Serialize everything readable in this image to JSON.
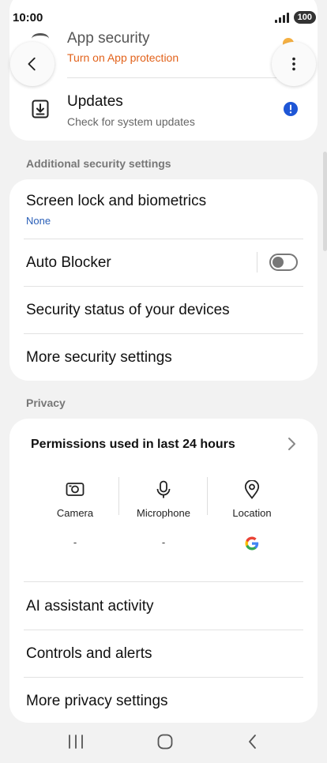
{
  "status": {
    "time": "10:00",
    "battery": "100"
  },
  "partial_top": {
    "glyph": "⠀"
  },
  "app_security": {
    "title": "App security",
    "subtitle": "Turn on App protection"
  },
  "updates": {
    "title": "Updates",
    "subtitle": "Check for system updates"
  },
  "additional": {
    "section_label": "Additional security settings",
    "screen_lock": {
      "title": "Screen lock and biometrics",
      "value": "None"
    },
    "auto_blocker": {
      "title": "Auto Blocker",
      "enabled": false
    },
    "device_status": {
      "title": "Security status of your devices"
    },
    "more_security": {
      "title": "More security settings"
    }
  },
  "privacy": {
    "section_label": "Privacy",
    "permissions": {
      "title": "Permissions used in last 24 hours",
      "items": [
        {
          "label": "Camera",
          "value": "-",
          "icon": "camera-icon"
        },
        {
          "label": "Microphone",
          "value": "-",
          "icon": "microphone-icon"
        },
        {
          "label": "Location",
          "value": "",
          "icon": "location-icon"
        }
      ]
    },
    "ai_activity": {
      "title": "AI assistant activity"
    },
    "controls_alerts": {
      "title": "Controls and alerts"
    },
    "more_privacy": {
      "title": "More privacy settings"
    }
  },
  "colors": {
    "accent_orange": "#e2621b",
    "info_blue": "#2a5fb8",
    "alert_badge": "#1e56d6"
  }
}
